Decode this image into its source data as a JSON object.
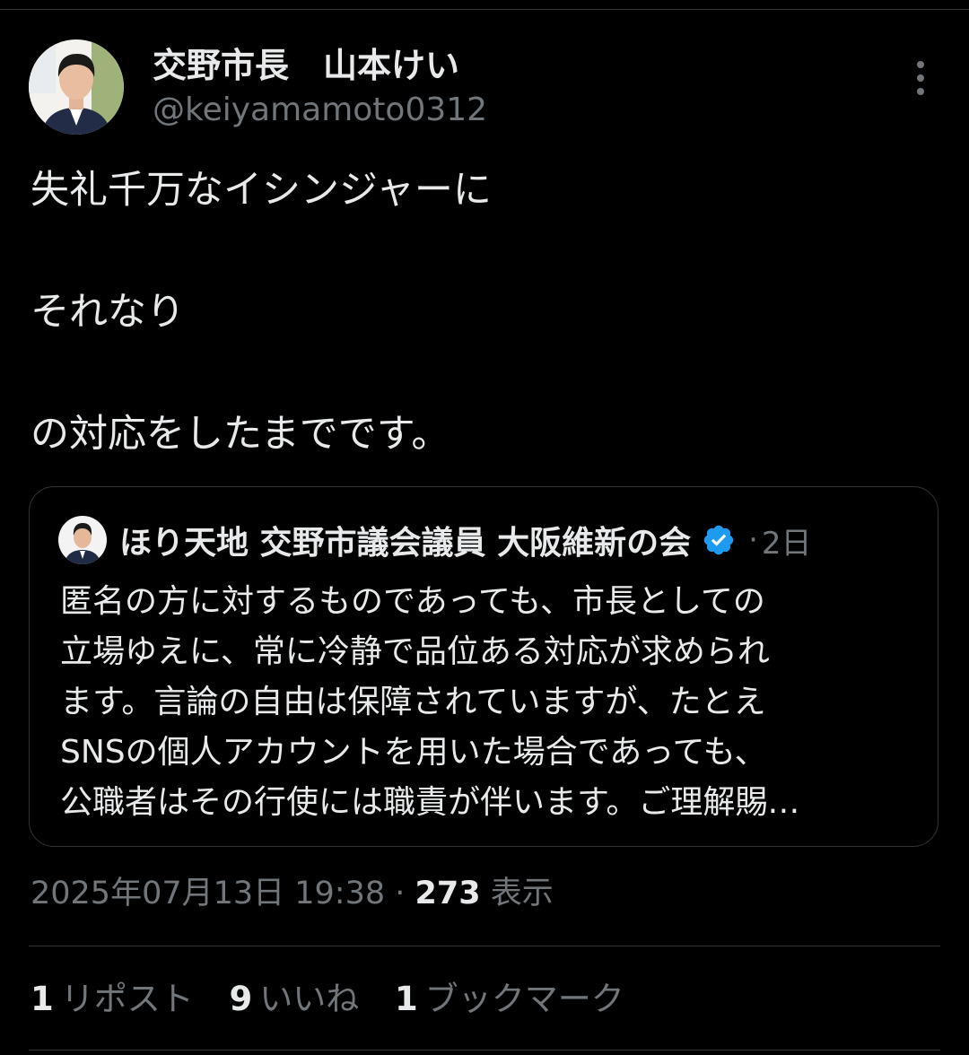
{
  "author": {
    "name": "交野市長　山本けい",
    "handle": "@keiyamamoto0312"
  },
  "tweet": {
    "lines": [
      "失礼千万なイシンジャーに",
      "それなり",
      "の対応をしたまでです。"
    ]
  },
  "quote": {
    "name": "ほり天地 交野市議会議員 大阪維新の会",
    "separator": "·",
    "time": "2日",
    "lines": [
      "匿名の方に対するものであっても、市長としての",
      "立場ゆえに、常に冷静で品位ある対応が求められ",
      "ます。言論の自由は保障されていますが、たとえ",
      "SNSの個人アカウントを用いた場合であっても、",
      "公職者はその行使には職責が伴います。ご理解賜…"
    ]
  },
  "meta": {
    "datetime": "2025年07月13日 19:38",
    "separator": " · ",
    "views_count": "273",
    "views_label": " 表示"
  },
  "stats": {
    "reposts_count": "1",
    "reposts_label": "リポスト",
    "likes_count": "9",
    "likes_label": "いいね",
    "bookmarks_count": "1",
    "bookmarks_label": "ブックマーク"
  },
  "icons": {
    "more": "more-vertical-icon",
    "verified": "verified-badge-icon"
  },
  "colors": {
    "background": "#000000",
    "text_primary": "#e7e9ea",
    "text_secondary": "#71767b",
    "border": "#2f3336",
    "verified_blue": "#1d9bf0"
  }
}
